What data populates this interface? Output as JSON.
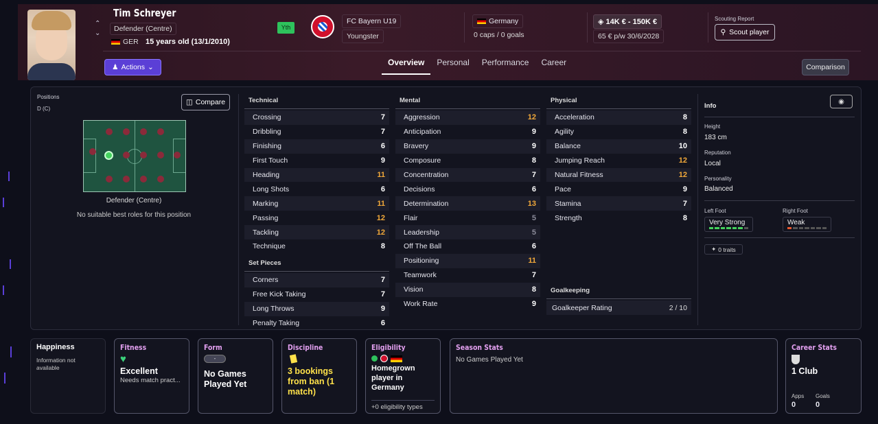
{
  "player": {
    "name": "Tim Schreyer",
    "position": "Defender (Centre)",
    "nationality_code": "GER",
    "age_text": "15 years old (13/1/2010)",
    "youth_badge": "Yth",
    "club": "FC Bayern U19",
    "club_status": "Youngster",
    "country": "Germany",
    "caps_goals": "0 caps / 0 goals",
    "value": "14K € - 150K €",
    "wage": "65 € p/w  30/6/2028"
  },
  "header": {
    "scouting_report_label": "Scouting Report",
    "scout_button": "Scout player",
    "actions_button": "Actions",
    "comparison_button": "Comparison",
    "tabs": [
      {
        "label": "Overview",
        "active": true
      },
      {
        "label": "Personal",
        "active": false
      },
      {
        "label": "Performance",
        "active": false
      },
      {
        "label": "Career",
        "active": false
      }
    ]
  },
  "positions": {
    "label": "Positions",
    "value": "D (C)",
    "compare_button": "Compare",
    "caption": "Defender (Centre)",
    "note": "No suitable best roles for this position"
  },
  "technical": {
    "title": "Technical",
    "attrs": [
      {
        "name": "Crossing",
        "value": "7",
        "tier": ""
      },
      {
        "name": "Dribbling",
        "value": "7",
        "tier": ""
      },
      {
        "name": "Finishing",
        "value": "6",
        "tier": ""
      },
      {
        "name": "First Touch",
        "value": "9",
        "tier": ""
      },
      {
        "name": "Heading",
        "value": "11",
        "tier": "hi"
      },
      {
        "name": "Long Shots",
        "value": "6",
        "tier": ""
      },
      {
        "name": "Marking",
        "value": "11",
        "tier": "hi"
      },
      {
        "name": "Passing",
        "value": "12",
        "tier": "hi"
      },
      {
        "name": "Tackling",
        "value": "12",
        "tier": "hi"
      },
      {
        "name": "Technique",
        "value": "8",
        "tier": ""
      }
    ]
  },
  "set_pieces": {
    "title": "Set Pieces",
    "attrs": [
      {
        "name": "Corners",
        "value": "7",
        "tier": ""
      },
      {
        "name": "Free Kick Taking",
        "value": "7",
        "tier": ""
      },
      {
        "name": "Long Throws",
        "value": "9",
        "tier": ""
      },
      {
        "name": "Penalty Taking",
        "value": "6",
        "tier": ""
      }
    ]
  },
  "mental": {
    "title": "Mental",
    "attrs": [
      {
        "name": "Aggression",
        "value": "12",
        "tier": "hi"
      },
      {
        "name": "Anticipation",
        "value": "9",
        "tier": ""
      },
      {
        "name": "Bravery",
        "value": "9",
        "tier": ""
      },
      {
        "name": "Composure",
        "value": "8",
        "tier": ""
      },
      {
        "name": "Concentration",
        "value": "7",
        "tier": ""
      },
      {
        "name": "Decisions",
        "value": "6",
        "tier": ""
      },
      {
        "name": "Determination",
        "value": "13",
        "tier": "hi"
      },
      {
        "name": "Flair",
        "value": "5",
        "tier": "lo"
      },
      {
        "name": "Leadership",
        "value": "5",
        "tier": "lo"
      },
      {
        "name": "Off The Ball",
        "value": "6",
        "tier": ""
      },
      {
        "name": "Positioning",
        "value": "11",
        "tier": "hi"
      },
      {
        "name": "Teamwork",
        "value": "7",
        "tier": ""
      },
      {
        "name": "Vision",
        "value": "8",
        "tier": ""
      },
      {
        "name": "Work Rate",
        "value": "9",
        "tier": ""
      }
    ]
  },
  "physical": {
    "title": "Physical",
    "attrs": [
      {
        "name": "Acceleration",
        "value": "8",
        "tier": ""
      },
      {
        "name": "Agility",
        "value": "8",
        "tier": ""
      },
      {
        "name": "Balance",
        "value": "10",
        "tier": ""
      },
      {
        "name": "Jumping Reach",
        "value": "12",
        "tier": "hi"
      },
      {
        "name": "Natural Fitness",
        "value": "12",
        "tier": "hi"
      },
      {
        "name": "Pace",
        "value": "9",
        "tier": ""
      },
      {
        "name": "Stamina",
        "value": "7",
        "tier": ""
      },
      {
        "name": "Strength",
        "value": "8",
        "tier": ""
      }
    ]
  },
  "goalkeeping": {
    "title": "Goalkeeping",
    "rating_label": "Goalkeeper Rating",
    "rating_value": "2 / 10"
  },
  "info": {
    "title": "Info",
    "height_label": "Height",
    "height": "183 cm",
    "reputation_label": "Reputation",
    "reputation": "Local",
    "personality_label": "Personality",
    "personality": "Balanced",
    "left_foot_label": "Left Foot",
    "left_foot": "Very Strong",
    "left_foot_level": 0.8,
    "right_foot_label": "Right Foot",
    "right_foot": "Weak",
    "right_foot_level": 0.2,
    "traits": "0 traits"
  },
  "cards": {
    "happiness": {
      "title": "Happiness",
      "text": "Information not available"
    },
    "fitness": {
      "title": "Fitness",
      "value": "Excellent",
      "sub": "Needs match pract..."
    },
    "form": {
      "title": "Form",
      "badge": "-",
      "value": "No Games Played Yet"
    },
    "discipline": {
      "title": "Discipline",
      "value": "3 bookings from ban (1 match)"
    },
    "eligibility": {
      "title": "Eligibility",
      "value": "Homegrown player in Germany",
      "sub": "+0 eligibility types"
    },
    "season": {
      "title": "Season Stats",
      "text": "No Games Played Yet"
    },
    "career": {
      "title": "Career Stats",
      "value": "1 Club",
      "apps_label": "Apps",
      "apps": "0",
      "goals_label": "Goals",
      "goals": "0"
    }
  },
  "colors": {
    "accent": "#5b3fd6",
    "highlight": "#f2a93a",
    "good": "#45d35e",
    "header_bg": "#3a1a28"
  }
}
